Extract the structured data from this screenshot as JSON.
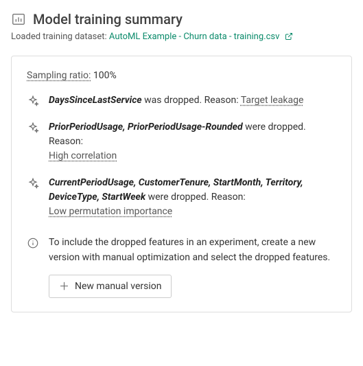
{
  "header": {
    "title": "Model training summary",
    "dataset_label": "Loaded training dataset:",
    "dataset_name": "AutoML Example - Churn data - training.csv"
  },
  "sampling": {
    "label": "Sampling ratio:",
    "value": "100%"
  },
  "drops": [
    {
      "features": "DaysSinceLastService",
      "suffix": " was dropped. Reason: ",
      "reason": "Target leakage"
    },
    {
      "features": "PriorPeriodUsage, PriorPeriodUsage-Rounded",
      "suffix": " were dropped. Reason:",
      "reason": "High correlation"
    },
    {
      "features": "CurrentPeriodUsage, CustomerTenure, StartMonth, Territory, DeviceType, StartWeek",
      "suffix": " were dropped. Reason:",
      "reason": "Low permutation importance"
    }
  ],
  "info": {
    "text": "To include the dropped features in an experiment, create a new version with manual optimization and select the dropped features.",
    "button_label": "New manual version"
  }
}
